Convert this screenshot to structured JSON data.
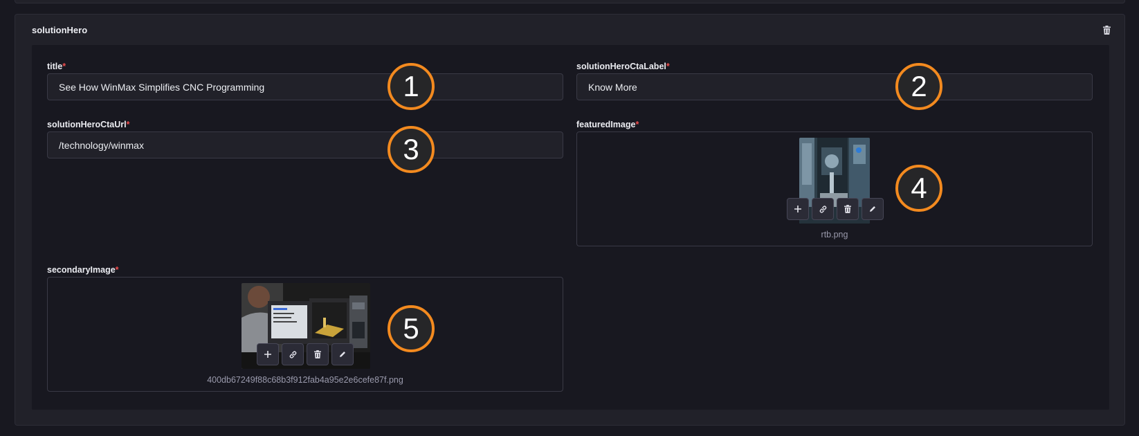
{
  "section": {
    "title": "solutionHero"
  },
  "required_mark": "*",
  "fields": {
    "title": {
      "label": "title",
      "value": "See How WinMax Simplifies CNC Programming"
    },
    "cta_label": {
      "label": "solutionHeroCtaLabel",
      "value": "Know More"
    },
    "cta_url": {
      "label": "solutionHeroCtaUrl",
      "value": "/technology/winmax"
    },
    "featured_image": {
      "label": "featuredImage",
      "filename": "rtb.png"
    },
    "secondary_image": {
      "label": "secondaryImage",
      "filename": "400db67249f88c68b3f912fab4a95e2e6cefe87f.png"
    }
  },
  "media_actions": [
    "add-icon",
    "link-icon",
    "trash-icon",
    "pencil-icon"
  ],
  "annotations": [
    "1",
    "2",
    "3",
    "4",
    "5"
  ],
  "colors": {
    "badge_ring": "#f38a1f",
    "required": "#ee4d4d",
    "background": "#181820",
    "panel": "#212129"
  }
}
